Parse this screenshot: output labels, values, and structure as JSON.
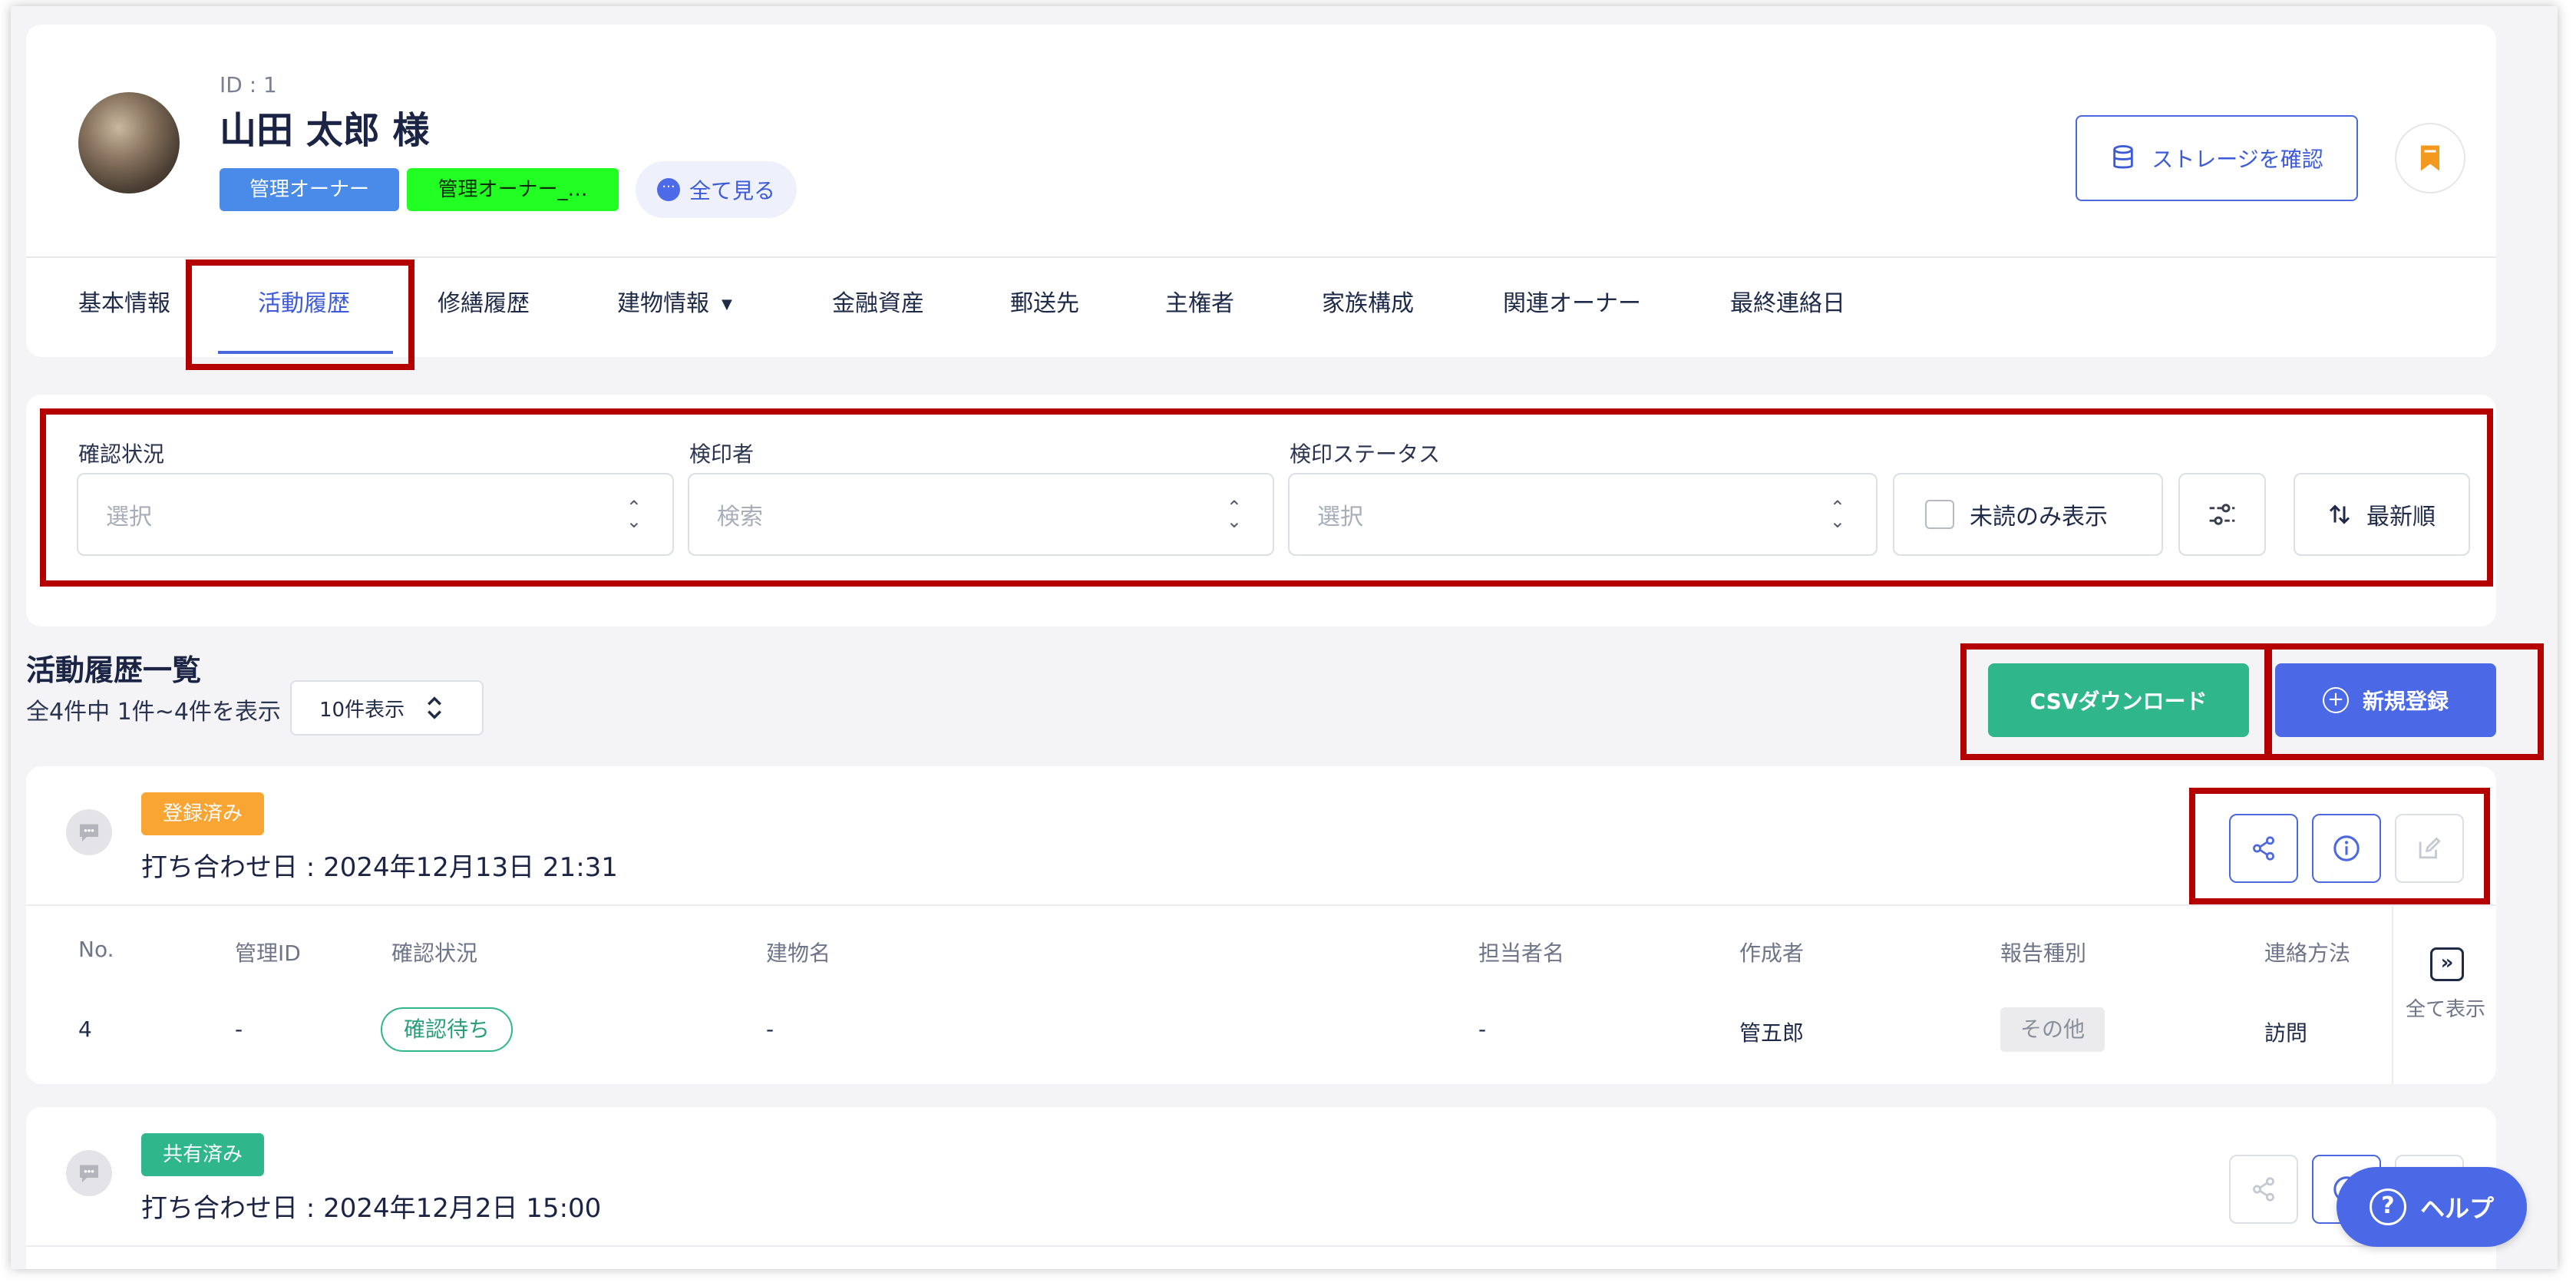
{
  "owner": {
    "id_label": "ID : 1",
    "name": "山田 太郎 様",
    "tags": [
      "管理オーナー",
      "管理オーナー_…"
    ],
    "see_all": "全て見る"
  },
  "header": {
    "storage_button": "ストレージを確認"
  },
  "tabs": [
    {
      "label": "基本情報"
    },
    {
      "label": "活動履歴"
    },
    {
      "label": "修繕履歴"
    },
    {
      "label": "建物情報"
    },
    {
      "label": "金融資産"
    },
    {
      "label": "郵送先"
    },
    {
      "label": "主権者"
    },
    {
      "label": "家族構成"
    },
    {
      "label": "関連オーナー"
    },
    {
      "label": "最終連絡日"
    }
  ],
  "filters": {
    "confirm_status": {
      "label": "確認状況",
      "placeholder": "選択"
    },
    "inspector": {
      "label": "検印者",
      "placeholder": "検索"
    },
    "inspection_status": {
      "label": "検印ステータス",
      "placeholder": "選択"
    },
    "unread_only": "未読のみ表示",
    "sort": "最新順"
  },
  "list": {
    "title": "活動履歴一覧",
    "count": "全4件中 1件~4件を表示",
    "per_page": "10件表示",
    "csv_button": "CSVダウンロード",
    "new_button": "新規登録"
  },
  "columns": [
    "No.",
    "管理ID",
    "確認状況",
    "建物名",
    "担当者名",
    "作成者",
    "報告種別",
    "連絡方法"
  ],
  "activities": [
    {
      "status": "登録済み",
      "meeting_date": "打ち合わせ日 : 2024年12月13日 21:31",
      "row": {
        "no": "4",
        "management_id": "-",
        "confirm_status": "確認待ち",
        "building": "-",
        "person": "-",
        "creator": "管五郎",
        "report_type": "その他",
        "contact_method": "訪問"
      },
      "show_all": "全て表示"
    },
    {
      "status": "共有済み",
      "meeting_date": "打ち合わせ日 : 2024年12月2日 15:00"
    }
  ],
  "help": "ヘルプ",
  "colors": {
    "primary": "#4b68e6",
    "success": "#2fb68a",
    "warning": "#f9a534",
    "highlight": "#b40000"
  }
}
